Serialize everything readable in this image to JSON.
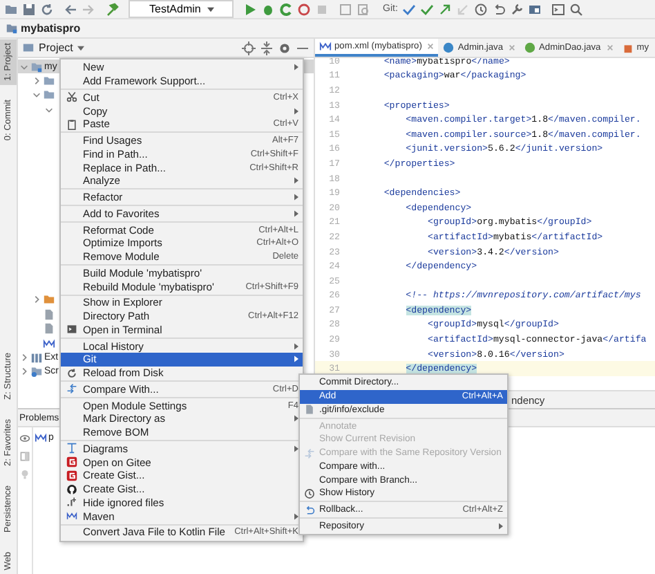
{
  "toolbar": {
    "run_config": "TestAdmin",
    "vcs_label": "Git:"
  },
  "navbar": {
    "project": "mybatispro"
  },
  "side_tabs": {
    "top": [
      {
        "label": "1: Project",
        "selected": true
      },
      {
        "label": "0: Commit",
        "selected": false
      }
    ],
    "bottom": [
      {
        "label": "Z: Structure",
        "selected": false
      },
      {
        "label": "2: Favorites",
        "selected": false
      },
      {
        "label": "Persistence",
        "selected": false
      },
      {
        "label": "Web",
        "selected": false
      }
    ]
  },
  "project_panel": {
    "title": "Project",
    "tree_upper": [
      {
        "label": "my",
        "kind": "module",
        "expanded": true,
        "selected": true,
        "children": [
          {
            "kind": "folder",
            "expanded": false,
            "selected": false
          },
          {
            "kind": "folder",
            "expanded": true,
            "selected": false,
            "children": [
              {
                "expanded": true,
                "selected": false
              }
            ]
          }
        ]
      }
    ],
    "tree_lower": [
      {
        "children": [
          {
            "kind": "resources-folder",
            "expanded": false,
            "selected": false
          },
          {
            "kind": "file",
            "selected": false
          },
          {
            "kind": "file",
            "selected": false
          },
          {
            "kind": "maven-file",
            "selected": false
          }
        ]
      },
      {
        "label": "Ext",
        "kind": "library",
        "expanded": false,
        "selected": false
      },
      {
        "label": "Scr",
        "kind": "scratches",
        "expanded": false,
        "selected": false
      }
    ]
  },
  "editor": {
    "tabs": [
      {
        "label": "pom.xml (mybatispro)",
        "kind": "maven",
        "selected": true,
        "closable": true
      },
      {
        "label": "Admin.java",
        "kind": "class",
        "selected": false,
        "closable": true
      },
      {
        "label": "AdminDao.java",
        "kind": "interface",
        "selected": false,
        "closable": true
      },
      {
        "label": "my",
        "kind": "jar",
        "selected": false,
        "closable": false
      }
    ],
    "lines": [
      {
        "number": "10",
        "text": "    <name>mybatispro</name>",
        "kind": "code",
        "current": false
      },
      {
        "number": "11",
        "text": "    <packaging>war</packaging>",
        "kind": "code",
        "current": false
      },
      {
        "number": "12",
        "current": false
      },
      {
        "number": "13",
        "text": "    <properties>",
        "kind": "code",
        "current": false
      },
      {
        "number": "14",
        "text": "        <maven.compiler.target>1.8</maven.compiler.",
        "kind": "code",
        "current": false
      },
      {
        "number": "15",
        "text": "        <maven.compiler.source>1.8</maven.compiler.",
        "kind": "code",
        "current": false
      },
      {
        "number": "16",
        "text": "        <junit.version>5.6.2</junit.version>",
        "kind": "code",
        "current": false
      },
      {
        "number": "17",
        "text": "    </properties>",
        "kind": "code",
        "current": false
      },
      {
        "number": "18",
        "current": false
      },
      {
        "number": "19",
        "text": "    <dependencies>",
        "kind": "code",
        "current": false
      },
      {
        "number": "20",
        "text": "        <dependency>",
        "kind": "code",
        "current": false
      },
      {
        "number": "21",
        "text": "            <groupId>org.mybatis</groupId>",
        "kind": "code",
        "current": false
      },
      {
        "number": "22",
        "text": "            <artifactId>mybatis</artifactId>",
        "kind": "code",
        "current": false
      },
      {
        "number": "23",
        "text": "            <version>3.4.2</version>",
        "kind": "code",
        "current": false
      },
      {
        "number": "24",
        "text": "        </dependency>",
        "kind": "code",
        "current": false
      },
      {
        "number": "25",
        "current": false
      },
      {
        "number": "26",
        "text": "        <!-- https://mvnrepository.com/artifact/mys",
        "kind": "comment",
        "current": false
      },
      {
        "number": "27",
        "text": "        <dependency>",
        "kind": "matched-tag",
        "current": false
      },
      {
        "number": "28",
        "text": "            <groupId>mysql</groupId>",
        "kind": "code",
        "current": false
      },
      {
        "number": "29",
        "text": "            <artifactId>mysql-connector-java</artifa",
        "kind": "code",
        "current": false
      },
      {
        "number": "30",
        "text": "            <version>8.0.16</version>",
        "kind": "code",
        "current": false
      },
      {
        "number": "31",
        "text": "        </dependency>",
        "kind": "matched-tag",
        "current": true
      }
    ],
    "breadcrumb": "ndency"
  },
  "problems_panel": {
    "title": "Problems",
    "rows": [
      {
        "kind": "maven",
        "label": "p"
      }
    ]
  },
  "context_menu": {
    "items": [
      {
        "kind": "plain",
        "label": "New",
        "submenu": true,
        "selected": false
      },
      {
        "kind": "plain",
        "label": "Add Framework Support...",
        "submenu": false,
        "selected": false
      },
      {
        "kind": "separator"
      },
      {
        "kind": "cut",
        "label": "Cut",
        "shortcut": "Ctrl+X",
        "submenu": false,
        "selected": false
      },
      {
        "kind": "plain",
        "label": "Copy",
        "submenu": true,
        "selected": false
      },
      {
        "kind": "paste",
        "label": "Paste",
        "shortcut": "Ctrl+V",
        "submenu": false,
        "selected": false
      },
      {
        "kind": "separator"
      },
      {
        "kind": "plain",
        "label": "Find Usages",
        "shortcut": "Alt+F7",
        "submenu": false,
        "selected": false
      },
      {
        "kind": "plain",
        "label": "Find in Path...",
        "shortcut": "Ctrl+Shift+F",
        "submenu": false,
        "selected": false
      },
      {
        "kind": "plain",
        "label": "Replace in Path...",
        "shortcut": "Ctrl+Shift+R",
        "submenu": false,
        "selected": false
      },
      {
        "kind": "plain",
        "label": "Analyze",
        "submenu": true,
        "selected": false
      },
      {
        "kind": "separator"
      },
      {
        "kind": "plain",
        "label": "Refactor",
        "submenu": true,
        "selected": false
      },
      {
        "kind": "separator"
      },
      {
        "kind": "plain",
        "label": "Add to Favorites",
        "submenu": true,
        "selected": false
      },
      {
        "kind": "separator"
      },
      {
        "kind": "plain",
        "label": "Reformat Code",
        "shortcut": "Ctrl+Alt+L",
        "submenu": false,
        "selected": false
      },
      {
        "kind": "plain",
        "label": "Optimize Imports",
        "shortcut": "Ctrl+Alt+O",
        "submenu": false,
        "selected": false
      },
      {
        "kind": "plain",
        "label": "Remove Module",
        "shortcut": "Delete",
        "submenu": false,
        "selected": false
      },
      {
        "kind": "separator"
      },
      {
        "kind": "plain",
        "label": "Build Module 'mybatispro'",
        "submenu": false,
        "selected": false
      },
      {
        "kind": "plain",
        "label": "Rebuild Module 'mybatispro'",
        "shortcut": "Ctrl+Shift+F9",
        "submenu": false,
        "selected": false
      },
      {
        "kind": "separator"
      },
      {
        "kind": "plain",
        "label": "Show in Explorer",
        "submenu": false,
        "selected": false
      },
      {
        "kind": "plain",
        "label": "Directory Path",
        "shortcut": "Ctrl+Alt+F12",
        "submenu": false,
        "selected": false
      },
      {
        "kind": "terminal",
        "label": "Open in Terminal",
        "submenu": false,
        "selected": false
      },
      {
        "kind": "separator"
      },
      {
        "kind": "plain",
        "label": "Local History",
        "submenu": true,
        "selected": false
      },
      {
        "kind": "plain",
        "label": "Git",
        "submenu": true,
        "selected": true
      },
      {
        "kind": "reload",
        "label": "Reload from Disk",
        "submenu": false,
        "selected": false
      },
      {
        "kind": "separator"
      },
      {
        "kind": "compare",
        "label": "Compare With...",
        "shortcut": "Ctrl+D",
        "submenu": false,
        "selected": false
      },
      {
        "kind": "separator"
      },
      {
        "kind": "plain",
        "label": "Open Module Settings",
        "shortcut": "F4",
        "submenu": false,
        "selected": false
      },
      {
        "kind": "plain",
        "label": "Mark Directory as",
        "submenu": true,
        "selected": false
      },
      {
        "kind": "plain",
        "label": "Remove BOM",
        "submenu": false,
        "selected": false
      },
      {
        "kind": "separator"
      },
      {
        "kind": "diagram",
        "label": "Diagrams",
        "submenu": true,
        "selected": false
      },
      {
        "kind": "gitee",
        "label": "Open on Gitee",
        "submenu": false,
        "selected": false
      },
      {
        "kind": "gitee",
        "label": "Create Gist...",
        "submenu": false,
        "selected": false
      },
      {
        "kind": "github",
        "label": "Create Gist...",
        "submenu": false,
        "selected": false
      },
      {
        "kind": "ignored",
        "label": "Hide ignored files",
        "submenu": false,
        "selected": false
      },
      {
        "kind": "maven",
        "label": "Maven",
        "submenu": true,
        "selected": false
      },
      {
        "kind": "separator"
      },
      {
        "kind": "plain",
        "label": "Convert Java File to Kotlin File",
        "shortcut": "Ctrl+Alt+Shift+K",
        "submenu": false,
        "selected": false
      }
    ]
  },
  "git_submenu": {
    "items": [
      {
        "kind": "plain",
        "label": "Commit Directory...",
        "submenu": false,
        "selected": false,
        "disabled": false
      },
      {
        "kind": "plain",
        "label": "Add",
        "shortcut": "Ctrl+Alt+A",
        "submenu": false,
        "selected": true,
        "disabled": false
      },
      {
        "kind": "file",
        "label": ".git/info/exclude",
        "submenu": false,
        "selected": false,
        "disabled": false
      },
      {
        "kind": "separator"
      },
      {
        "kind": "plain",
        "label": "Annotate",
        "submenu": false,
        "selected": false,
        "disabled": true
      },
      {
        "kind": "plain",
        "label": "Show Current Revision",
        "submenu": false,
        "selected": false,
        "disabled": true
      },
      {
        "kind": "compare",
        "label": "Compare with the Same Repository Version",
        "submenu": false,
        "selected": false,
        "disabled": true
      },
      {
        "kind": "plain",
        "label": "Compare with...",
        "submenu": false,
        "selected": false,
        "disabled": false
      },
      {
        "kind": "plain",
        "label": "Compare with Branch...",
        "submenu": false,
        "selected": false,
        "disabled": false
      },
      {
        "kind": "history",
        "label": "Show History",
        "submenu": false,
        "selected": false,
        "disabled": false
      },
      {
        "kind": "separator"
      },
      {
        "kind": "rollback",
        "label": "Rollback...",
        "shortcut": "Ctrl+Alt+Z",
        "submenu": false,
        "selected": false,
        "disabled": false
      },
      {
        "kind": "separator"
      },
      {
        "kind": "plain",
        "label": "Repository",
        "submenu": true,
        "selected": false,
        "disabled": false
      }
    ]
  }
}
